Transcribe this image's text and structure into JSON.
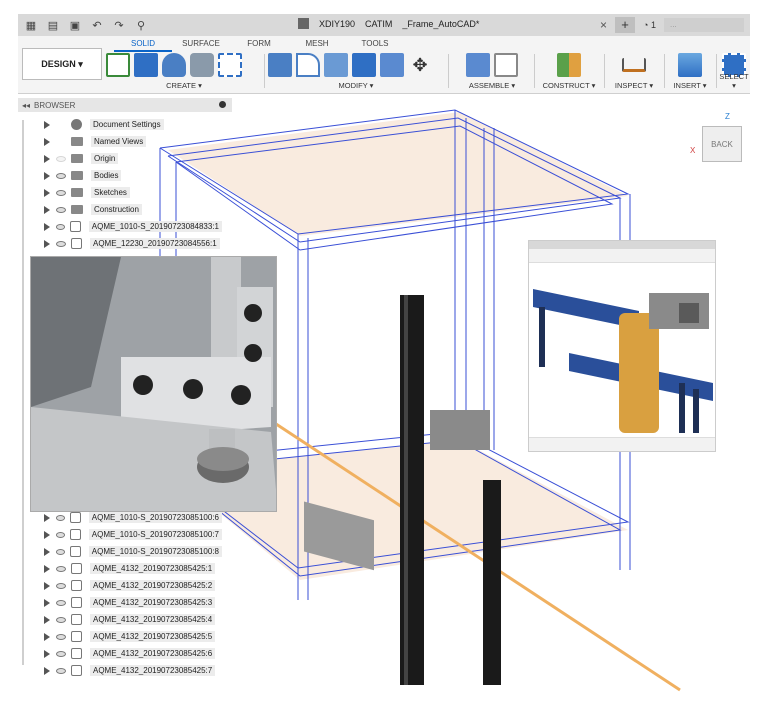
{
  "titlebar": {
    "doc_project": "XDIY190",
    "doc_user": "CATIM",
    "doc_title": "_Frame_AutoCAD*",
    "close": "×",
    "plus": "+",
    "clock": "1",
    "user_name": "..."
  },
  "toolbar": {
    "design_label": "DESIGN ▾",
    "tabs": [
      {
        "label": "SOLID"
      },
      {
        "label": "SURFACE"
      },
      {
        "label": "FORM"
      },
      {
        "label": "MESH"
      },
      {
        "label": "TOOLS"
      }
    ],
    "groups": [
      {
        "label": "CREATE ▾"
      },
      {
        "label": "MODIFY ▾"
      },
      {
        "label": "ASSEMBLE ▾"
      },
      {
        "label": "CONSTRUCT ▾"
      },
      {
        "label": "INSPECT ▾"
      },
      {
        "label": "INSERT ▾"
      },
      {
        "label": "SELECT ▾"
      }
    ]
  },
  "browser": {
    "title": "BROWSER",
    "collapse": "◂◂"
  },
  "tree": [
    {
      "label": "Document Settings",
      "icon": "gear-icon",
      "eye": false
    },
    {
      "label": "Named Views",
      "icon": "folder-icon",
      "eye": false
    },
    {
      "label": "Origin",
      "icon": "folder-icon",
      "eye": true,
      "eye_dim": true
    },
    {
      "label": "Bodies",
      "icon": "folder-icon",
      "eye": true
    },
    {
      "label": "Sketches",
      "icon": "folder-icon",
      "eye": true
    },
    {
      "label": "Construction",
      "icon": "folder-icon",
      "eye": true
    },
    {
      "label": "AQME_1010-S_20190723084833:1",
      "icon": "component-icon",
      "eye": true
    },
    {
      "label": "AQME_12230_20190723084556:1",
      "icon": "component-icon",
      "eye": true
    }
  ],
  "tree_lower": [
    {
      "label": "AQME_1010-S_20190723085100:6",
      "icon": "component-icon",
      "eye": true
    },
    {
      "label": "AQME_1010-S_20190723085100:7",
      "icon": "component-icon",
      "eye": true
    },
    {
      "label": "AQME_1010-S_20190723085100:8",
      "icon": "component-icon",
      "eye": true
    },
    {
      "label": "AQME_4132_20190723085425:1",
      "icon": "component-icon",
      "eye": true
    },
    {
      "label": "AQME_4132_20190723085425:2",
      "icon": "component-icon",
      "eye": true
    },
    {
      "label": "AQME_4132_20190723085425:3",
      "icon": "component-icon",
      "eye": true
    },
    {
      "label": "AQME_4132_20190723085425:4",
      "icon": "component-icon",
      "eye": true
    },
    {
      "label": "AQME_4132_20190723085425:5",
      "icon": "component-icon",
      "eye": true
    },
    {
      "label": "AQME_4132_20190723085425:6",
      "icon": "component-icon",
      "eye": true
    },
    {
      "label": "AQME_4132_20190723085425:7",
      "icon": "component-icon",
      "eye": true
    }
  ],
  "viewcube": {
    "face_label": "BACK",
    "axis_z": "Z",
    "axis_x": "X"
  },
  "colors": {
    "accent": "#0a64c8",
    "frame_lines": "#3a4fd6",
    "panel_fill": "#f7e3d2",
    "rod": "#f0b060",
    "inset_blue": "#2a4f9a",
    "inset_orange": "#d9a040"
  }
}
